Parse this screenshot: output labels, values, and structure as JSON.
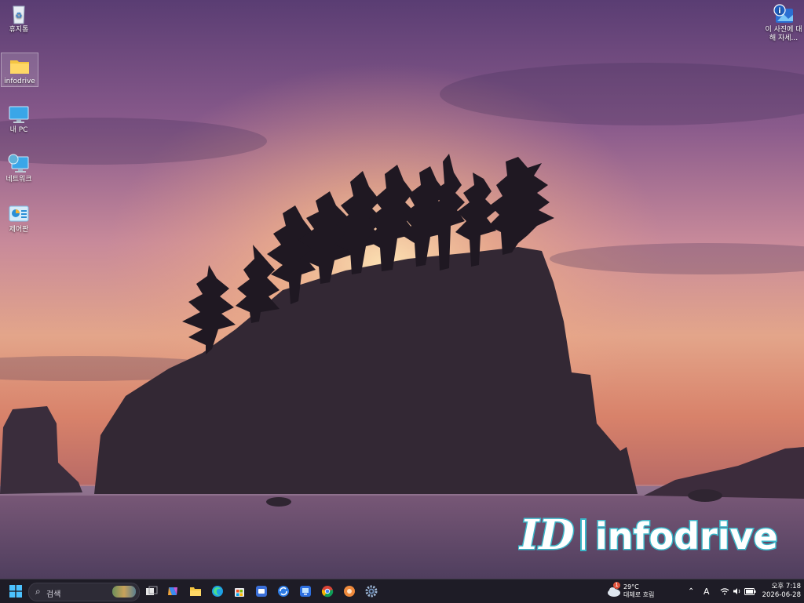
{
  "desktop": {
    "icons": [
      {
        "label": "휴지통",
        "icon": "recycle-bin-icon"
      },
      {
        "label": "infodrive",
        "icon": "folder-icon"
      },
      {
        "label": "내 PC",
        "icon": "monitor-icon"
      },
      {
        "label": "네트워크",
        "icon": "network-icon"
      },
      {
        "label": "제어판",
        "icon": "control-panel-icon"
      }
    ],
    "spotlight": {
      "label": "이 사진에 대해 자세...",
      "icon": "learn-about-picture-icon"
    }
  },
  "watermark": {
    "mark": "ID",
    "text": "infodrive"
  },
  "taskbar": {
    "search_placeholder": "검색",
    "pinned": [
      "task-view-icon",
      "copilot-icon",
      "file-explorer-icon",
      "edge-icon",
      "store-icon",
      "app-blue-icon",
      "app-sync-icon",
      "app-remote-icon",
      "chrome-icon",
      "app-orange-icon",
      "settings-icon"
    ],
    "weather": {
      "temp": "29°C",
      "desc": "대체로 흐림",
      "badge": "1"
    },
    "tray": {
      "ime": "A"
    },
    "clock": {
      "time": "오후 7:18",
      "date": "2026-06-28"
    }
  }
}
